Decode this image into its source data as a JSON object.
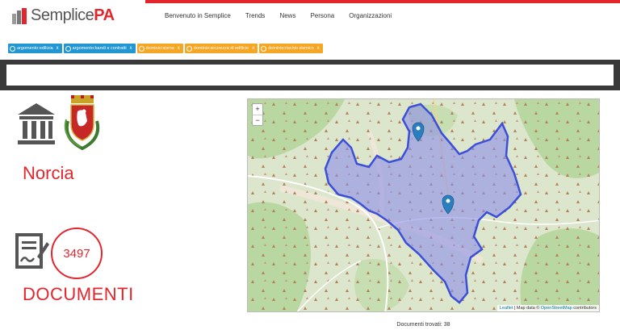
{
  "header": {
    "logo_prefix": "Semplice",
    "logo_suffix": "PA",
    "brand_color": "#e3262d",
    "nav": [
      "Benvenuto in Semplice",
      "Trends",
      "News",
      "Persona",
      "Organizzazioni"
    ]
  },
  "tags": [
    {
      "label": "argomento:edilizia",
      "color": "blue",
      "remove": "x"
    },
    {
      "label": "argomento:bandi e contratti",
      "color": "blue",
      "remove": "x"
    },
    {
      "label": "dominio:sisma",
      "color": "orange",
      "remove": "x"
    },
    {
      "label": "dominio:sicurezza di edificio",
      "color": "orange",
      "remove": "x"
    },
    {
      "label": "dominio:rischio sismico",
      "color": "orange",
      "remove": "x"
    }
  ],
  "search": {
    "value": "",
    "placeholder": ""
  },
  "entity": {
    "name": "Norcia",
    "institution_icon": "institution-icon",
    "coat_of_arms": "coat-of-arms-icon"
  },
  "documents": {
    "count": "3497",
    "label": "DOCUMENTI",
    "icon": "document-signature-icon"
  },
  "map": {
    "zoom_in": "+",
    "zoom_out": "−",
    "attribution_leaflet": "Leaflet",
    "attribution_sep": " | Map data © ",
    "attribution_osm": "OpenStreetMap",
    "attribution_tail": " contributors",
    "polygon_color": "#3b4fd8",
    "polygon_fill": "#8c8fe8"
  },
  "footer": {
    "found_text": "Documenti trovati: 38"
  }
}
